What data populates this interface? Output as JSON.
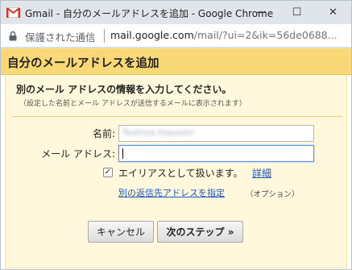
{
  "window": {
    "title": "Gmail - 自分のメールアドレスを追加 - Google Chrome",
    "minimize_symbol": "—",
    "maximize_symbol": "☐",
    "close_symbol": "✕"
  },
  "addressbar": {
    "security_label": "保護された通信",
    "url_host": "mail.google.com",
    "url_path": "/mail/?ui=2&ik=56de0688..."
  },
  "dialog": {
    "title": "自分のメールアドレスを追加",
    "intro_heading": "別のメール アドレスの情報を入力してください。",
    "intro_note": "（設定した名前とメール アドレスが送信するメールに表示されます）",
    "name_label": "名前:",
    "name_value": "Toshiya Hayashi",
    "email_label": "メール アドレス:",
    "email_value": "",
    "alias_checked": true,
    "alias_label": "エイリアスとして扱います。",
    "alias_detail_link": "詳細",
    "reply_to_link": "別の返信先アドレスを指定",
    "reply_to_option": "（オプション）",
    "cancel_button": "キャンセル",
    "next_button": "次のステップ »"
  },
  "colors": {
    "header_bg": "#f9d878",
    "panel_bg": "#fff8dc",
    "link": "#1a56c5",
    "focus_border": "#4d90fe"
  }
}
